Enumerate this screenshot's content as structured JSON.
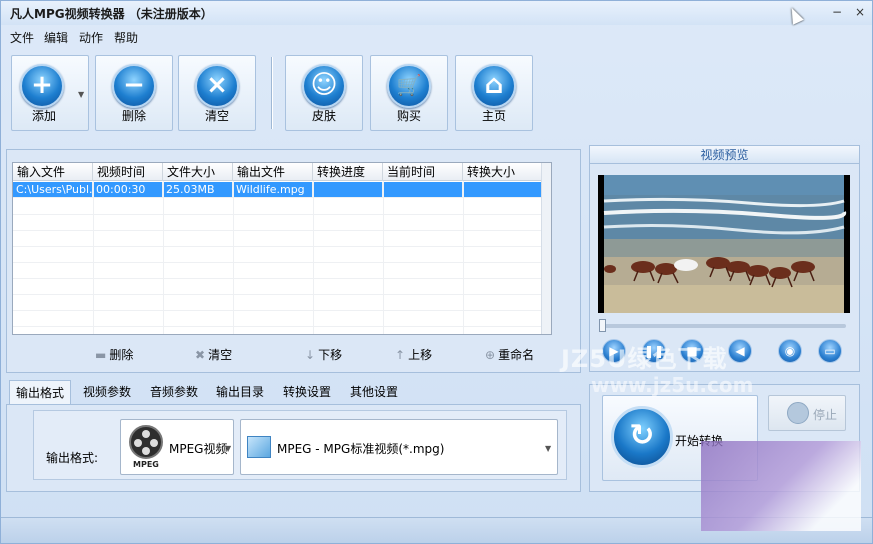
{
  "window": {
    "title": "凡人MPG视频转换器 （未注册版本）",
    "minimize": "−",
    "close": "×"
  },
  "menu": [
    "文件",
    "编辑",
    "动作",
    "帮助"
  ],
  "toolbar": {
    "add": "添加",
    "add_glyph": "+",
    "delete": "删除",
    "delete_glyph": "−",
    "clear": "清空",
    "clear_glyph": "×",
    "skin": "皮肤",
    "skin_glyph": "☺",
    "buy": "购买",
    "buy_glyph": "🛒",
    "home": "主页",
    "home_glyph": "⌂"
  },
  "file_table": {
    "columns": [
      "输入文件",
      "视频时间",
      "文件大小",
      "输出文件",
      "转换进度",
      "当前时间",
      "转换大小"
    ],
    "rows": [
      [
        "C:\\Users\\Publ...",
        "00:00:30",
        "25.03MB",
        "Wildlife.mpg",
        "",
        "",
        ""
      ]
    ]
  },
  "list_actions": {
    "delete": "删除",
    "clear": "清空",
    "down": "下移",
    "up": "上移",
    "rename": "重命名"
  },
  "preview": {
    "title": "视频预览"
  },
  "tabs": [
    "输出格式",
    "视频参数",
    "音频参数",
    "输出目录",
    "转换设置",
    "其他设置"
  ],
  "format": {
    "label": "输出格式:",
    "category": "MPEG视频",
    "category_tag": "MPEG",
    "profile": "MPEG - MPG标准视频(*.mpg)"
  },
  "convert": {
    "start": "开始转换",
    "stop": "停止"
  },
  "watermark": {
    "line1": "JZ5U绿色下载",
    "line2": "www.jz5u.com"
  }
}
